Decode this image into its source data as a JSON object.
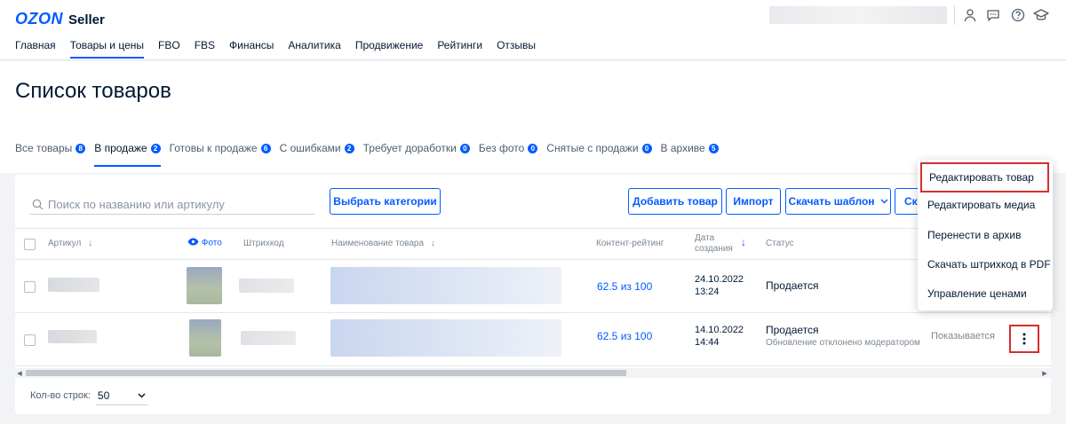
{
  "header": {
    "logo_brand": "OZON",
    "logo_suffix": "Seller",
    "nav": [
      {
        "label": "Главная",
        "active": false
      },
      {
        "label": "Товары и цены",
        "active": true
      },
      {
        "label": "FBO",
        "active": false
      },
      {
        "label": "FBS",
        "active": false
      },
      {
        "label": "Финансы",
        "active": false
      },
      {
        "label": "Аналитика",
        "active": false
      },
      {
        "label": "Продвижение",
        "active": false
      },
      {
        "label": "Рейтинги",
        "active": false
      },
      {
        "label": "Отзывы",
        "active": false
      }
    ],
    "icons": [
      "user-icon",
      "chat-icon",
      "help-icon",
      "education-icon"
    ]
  },
  "page": {
    "title": "Список товаров",
    "tabs": [
      {
        "label": "Все товары",
        "count": "8",
        "active": false
      },
      {
        "label": "В продаже",
        "count": "2",
        "active": true
      },
      {
        "label": "Готовы к продаже",
        "count": "6",
        "active": false
      },
      {
        "label": "С ошибками",
        "count": "2",
        "active": false
      },
      {
        "label": "Требует доработки",
        "count": "0",
        "active": false
      },
      {
        "label": "Без фото",
        "count": "0",
        "active": false
      },
      {
        "label": "Снятые с продажи",
        "count": "0",
        "active": false
      },
      {
        "label": "В архиве",
        "count": "5",
        "active": false
      }
    ]
  },
  "toolbar": {
    "search_placeholder": "Поиск по названию или артикулу",
    "categories_button": "Выбрать категории",
    "add_button": "Добавить товар",
    "import_button": "Импорт",
    "template_button": "Скачать шаблон",
    "cut_button": "Ска"
  },
  "table": {
    "columns": {
      "article": "Артикул",
      "photo": "Фото",
      "barcode": "Штрихкод",
      "name": "Наименование товара",
      "content_rating": "Контент-рейтинг",
      "created_line1": "Дата",
      "created_line2": "создания",
      "status": "Статус"
    },
    "rows": [
      {
        "rating": "62.5 из 100",
        "date": "24.10.2022",
        "time": "13:24",
        "status": "Продается",
        "status_note": "",
        "visibility": ""
      },
      {
        "rating": "62.5 из 100",
        "date": "14.10.2022",
        "time": "14:44",
        "status": "Продается",
        "status_note": "Обновление отклонено модератором",
        "visibility": "Показывается"
      }
    ]
  },
  "footer": {
    "rows_label": "Кол-во строк:",
    "rows_value": "50"
  },
  "context_menu": {
    "items": [
      {
        "label": "Редактировать товар",
        "highlighted": true
      },
      {
        "label": "Редактировать медиа",
        "highlighted": false
      },
      {
        "label": "Перенести в архив",
        "highlighted": false
      },
      {
        "label": "Скачать штрихкод в PDF",
        "highlighted": false
      },
      {
        "label": "Управление ценами",
        "highlighted": false
      }
    ]
  },
  "colors": {
    "accent": "#005bff",
    "highlight_border": "#d32f2f",
    "text": "#001a34",
    "muted": "#7b8794"
  }
}
